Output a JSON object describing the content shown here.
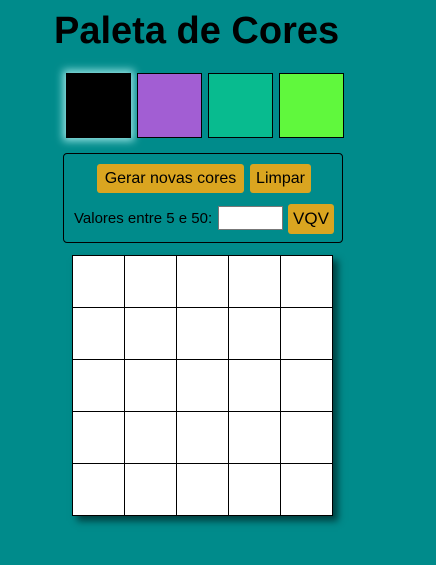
{
  "header": {
    "title": "Paleta de Cores"
  },
  "palette": {
    "colors": [
      {
        "name": "black",
        "hex": "#000000",
        "selected": true
      },
      {
        "name": "purple",
        "hex": "#a25ed3",
        "selected": false
      },
      {
        "name": "teal",
        "hex": "#08bb8f",
        "selected": false
      },
      {
        "name": "green",
        "hex": "#60f83d",
        "selected": false
      }
    ]
  },
  "controls": {
    "generate_label": "Gerar novas cores",
    "clear_label": "Limpar",
    "size_label": "Valores entre 5 e 50:",
    "size_input_value": "",
    "size_input_placeholder": "",
    "vqv_label": "VQV"
  },
  "board": {
    "rows": 5,
    "cols": 5,
    "pixel_color": "#ffffff"
  },
  "theme": {
    "background": "#008b8b",
    "button": "#daa520"
  }
}
